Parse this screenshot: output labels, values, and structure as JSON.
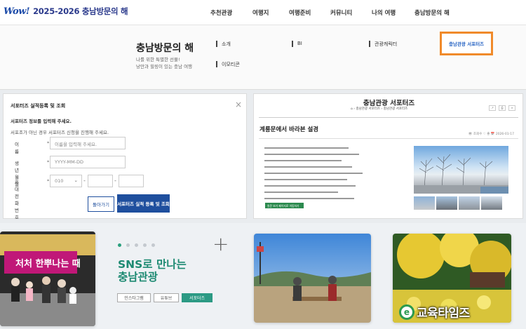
{
  "header": {
    "logo_script": "Wow!",
    "logo_title": "2025-2026 충남방문의 해",
    "nav": [
      "추천관광",
      "여행지",
      "여행준비",
      "커뮤니티",
      "나의 여행",
      "충남방문의 해"
    ]
  },
  "mega_menu": {
    "title": "충남방문의 해",
    "desc_line1": "나를 위한 특별한 선물!",
    "desc_line2": "낭만과 힐링이 있는 충남 여행",
    "links": [
      "소개",
      "BI",
      "관광캐릭터",
      "이모티콘"
    ],
    "highlight": "충남관광 서포터즈"
  },
  "form_panel": {
    "title": "서포터즈 실적등록 및 조회",
    "close": "×",
    "subtitle": "서포터즈 정보를 입력해 주세요.",
    "note": "서포조가 아닌 경우 서포터즈 신청을 진행해 주세요.",
    "fields": {
      "name_label": "이름",
      "name_placeholder": "이름을 입력해 주세요.",
      "birth_label": "생년월일",
      "birth_placeholder": "YYYY-MM-DD",
      "phone_label": "휴대전화번호",
      "phone_prefix": "010",
      "phone_sep": "-",
      "bullet": "*"
    },
    "buttons": {
      "back": "돌아가기",
      "submit": "서포터즈 실적 등록 및 조회"
    }
  },
  "preview_panel": {
    "title": "충남관광 서포터즈",
    "breadcrumb": "⌂  ›  충남관광 서포터즈  ›  충남관광 서포터즈",
    "post_title": "계룡문에서 바라본 설경",
    "meta": "👁 조회수     ♡ 좋          📅 2026-01-17",
    "button_label": "원문 보기 페이지로 이동하기 →"
  },
  "sns": {
    "line1": "SNS로 만나는",
    "line2": "충남관광",
    "tags": [
      "인스타그램",
      "유튜브",
      "서포터즈"
    ],
    "active_tag": 2,
    "card1_banner": "처처  한뿌나는 때"
  },
  "watermark": {
    "icon": "e",
    "text": "교육타임즈"
  },
  "colors": {
    "accent_green": "#2c9a84",
    "brand_blue": "#1f4f9e",
    "highlight_orange": "#f08a2a"
  }
}
